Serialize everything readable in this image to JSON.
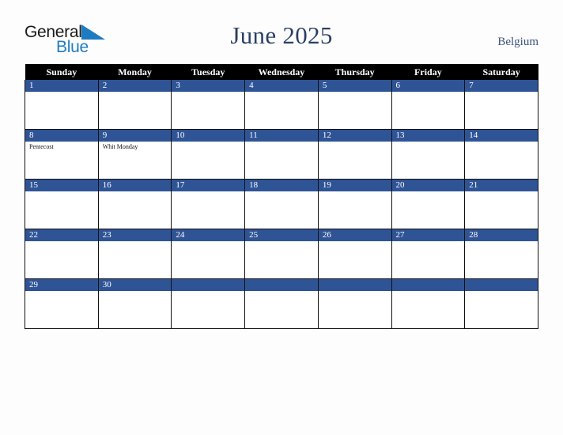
{
  "brand": {
    "name_top": "General",
    "name_bottom": "Blue",
    "triangle_icon": "triangle-icon",
    "top_color": "#1a1a1a",
    "bottom_color": "#1f7bc1"
  },
  "header": {
    "title": "June 2025",
    "country": "Belgium",
    "title_color": "#2b3f66",
    "country_color": "#3a5180"
  },
  "calendar": {
    "month": "June",
    "year": "2025",
    "weekday_headers": [
      "Sunday",
      "Monday",
      "Tuesday",
      "Wednesday",
      "Thursday",
      "Friday",
      "Saturday"
    ],
    "header_bg": "#000000",
    "header_text_color": "#ffffff",
    "date_band_color": "#2f5496",
    "date_text_color": "#ffffff",
    "cell_bg": "#ffffff",
    "grid_line_color": "#111111",
    "weeks": [
      [
        {
          "date": "1",
          "events": []
        },
        {
          "date": "2",
          "events": []
        },
        {
          "date": "3",
          "events": []
        },
        {
          "date": "4",
          "events": []
        },
        {
          "date": "5",
          "events": []
        },
        {
          "date": "6",
          "events": []
        },
        {
          "date": "7",
          "events": []
        }
      ],
      [
        {
          "date": "8",
          "events": [
            "Pentecost"
          ]
        },
        {
          "date": "9",
          "events": [
            "Whit Monday"
          ]
        },
        {
          "date": "10",
          "events": []
        },
        {
          "date": "11",
          "events": []
        },
        {
          "date": "12",
          "events": []
        },
        {
          "date": "13",
          "events": []
        },
        {
          "date": "14",
          "events": []
        }
      ],
      [
        {
          "date": "15",
          "events": []
        },
        {
          "date": "16",
          "events": []
        },
        {
          "date": "17",
          "events": []
        },
        {
          "date": "18",
          "events": []
        },
        {
          "date": "19",
          "events": []
        },
        {
          "date": "20",
          "events": []
        },
        {
          "date": "21",
          "events": []
        }
      ],
      [
        {
          "date": "22",
          "events": []
        },
        {
          "date": "23",
          "events": []
        },
        {
          "date": "24",
          "events": []
        },
        {
          "date": "25",
          "events": []
        },
        {
          "date": "26",
          "events": []
        },
        {
          "date": "27",
          "events": []
        },
        {
          "date": "28",
          "events": []
        }
      ],
      [
        {
          "date": "29",
          "events": []
        },
        {
          "date": "30",
          "events": []
        },
        {
          "date": "",
          "events": []
        },
        {
          "date": "",
          "events": []
        },
        {
          "date": "",
          "events": []
        },
        {
          "date": "",
          "events": []
        },
        {
          "date": "",
          "events": []
        }
      ]
    ]
  }
}
